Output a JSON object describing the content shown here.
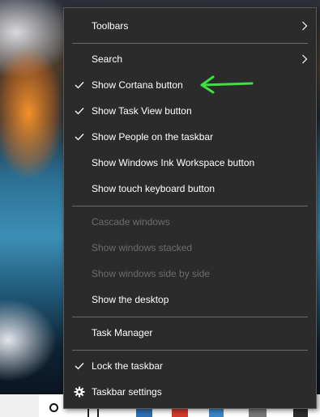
{
  "menu": {
    "items": {
      "toolbars": {
        "label": "Toolbars",
        "submenu": true
      },
      "search": {
        "label": "Search",
        "submenu": true
      },
      "cortana": {
        "label": "Show Cortana button",
        "checked": true
      },
      "taskview": {
        "label": "Show Task View button",
        "checked": true
      },
      "people": {
        "label": "Show People on the taskbar",
        "checked": true
      },
      "ink": {
        "label": "Show Windows Ink Workspace button",
        "checked": false
      },
      "touch_keyboard": {
        "label": "Show touch keyboard button",
        "checked": false
      },
      "cascade": {
        "label": "Cascade windows",
        "disabled": true
      },
      "stacked": {
        "label": "Show windows stacked",
        "disabled": true
      },
      "side_by_side": {
        "label": "Show windows side by side",
        "disabled": true
      },
      "desktop": {
        "label": "Show the desktop"
      },
      "task_manager": {
        "label": "Task Manager"
      },
      "lock": {
        "label": "Lock the taskbar",
        "checked": true
      },
      "settings": {
        "label": "Taskbar settings",
        "icon": "gear-icon"
      }
    }
  },
  "annotation": {
    "icon": "green-arrow-icon",
    "color": "#3fe03f"
  },
  "colors": {
    "menu_background": "#2b2b2b",
    "menu_text": "#ffffff",
    "disabled_text": "#6d6d6d",
    "separator": "#6a6a6a"
  }
}
